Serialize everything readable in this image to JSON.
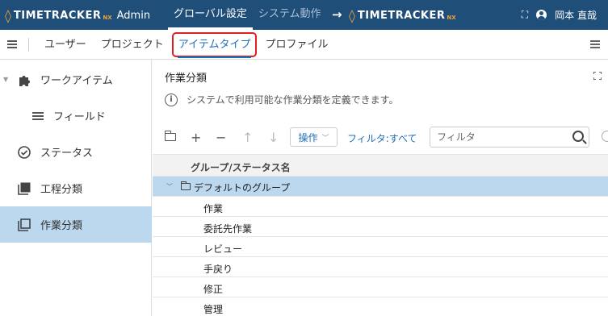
{
  "header": {
    "brand": "TIMETRACKER",
    "brand_suffix": "NX",
    "brand_mode": "Admin",
    "tabs": [
      {
        "label": "グローバル設定",
        "active": true
      },
      {
        "label": "システム動作",
        "active": false
      }
    ],
    "link_brand": "TIMETRACKER",
    "link_brand_suffix": "NX",
    "user_name": "岡本 直哉"
  },
  "subnav": {
    "tabs": [
      {
        "label": "ユーザー",
        "active": false
      },
      {
        "label": "プロジェクト",
        "active": false
      },
      {
        "label": "アイテムタイプ",
        "active": true
      },
      {
        "label": "プロファイル",
        "active": false
      }
    ]
  },
  "sidebar": {
    "items": [
      {
        "label": "ワークアイテム",
        "icon": "puzzle-icon"
      },
      {
        "label": "フィールド",
        "icon": "list-lines-icon"
      },
      {
        "label": "ステータス",
        "icon": "check-circle-icon"
      },
      {
        "label": "工程分類",
        "icon": "square-stack-icon"
      },
      {
        "label": "作業分類",
        "icon": "square-stack-icon",
        "active": true
      }
    ]
  },
  "content": {
    "title": "作業分類",
    "info_text": "システムで利用可能な作業分類を定義できます。",
    "toolbar": {
      "operation_label": "操作",
      "filter_link": "フィルタ:すべて",
      "filter_placeholder": "フィルタ"
    },
    "column_header": "グループ/ステータス名",
    "group": {
      "label": "デフォルトのグループ"
    },
    "items": [
      "作業",
      "委託先作業",
      "レビュー",
      "手戻り",
      "修正",
      "管理"
    ]
  },
  "colors": {
    "header_bg": "#1f4e79",
    "accent": "#1f6fb8",
    "selection": "#bcd8ef",
    "logo_accent": "#e9a13b",
    "highlight_box": "#e02020"
  }
}
